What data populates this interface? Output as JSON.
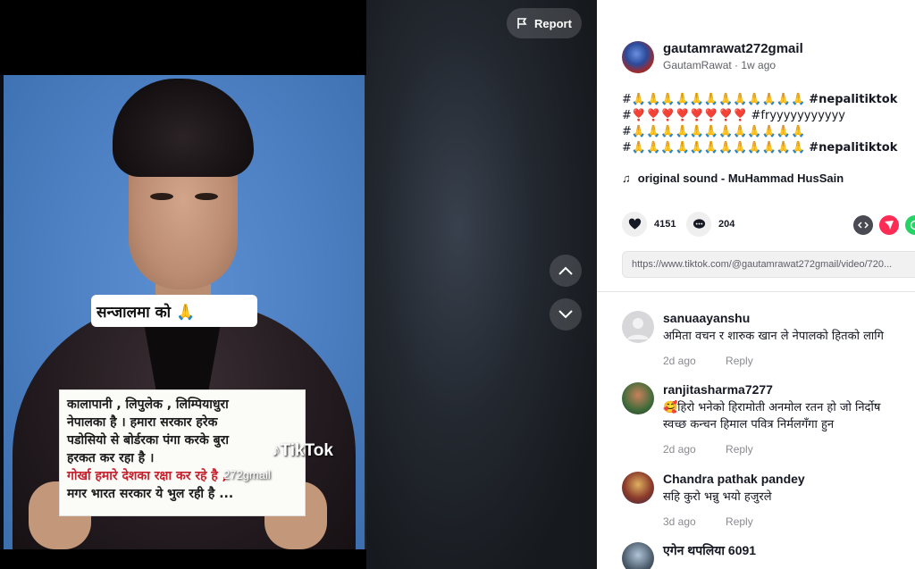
{
  "video": {
    "report_label": "Report",
    "overlay_caption": "सन्जालमा     को 🙏",
    "note_lines": [
      "कालापानी , लिपुलेक ,  लिम्पियाधुरा",
      "नेपालका है ।   हमारा सरकार हरेक",
      "पडोसियो से बोर्डरका पंगा करके बुरा",
      "हरकत कर रहा है ।"
    ],
    "note_red_line": "गोर्खा हमारे देशका रक्षा कर रहे है ,",
    "note_last_line": "मगर भारत सरकार ये भुल रही है ...",
    "watermark": "TikTok",
    "watermark_user": "272gmail"
  },
  "author": {
    "username": "gautamrawat272gmail",
    "display_name": "GautamRawat",
    "time_ago": "1w ago"
  },
  "description": {
    "line1_prefix": "#🙏🙏🙏🙏🙏🙏🙏🙏🙏🙏🙏🙏",
    "line1_tag": "#nepalitiktok",
    "line2_prefix": "#❣️❣️❣️❣️❣️❣️❣️❣️",
    "line2_tag": "#fryyyyyyyyyyy",
    "line3": "#🙏🙏🙏🙏🙏🙏🙏🙏🙏🙏🙏🙏",
    "line4_prefix": "#🙏🙏🙏🙏🙏🙏🙏🙏🙏🙏🙏🙏",
    "line4_tag": "#nepalitiktok"
  },
  "sound": {
    "label": "original sound - MuHammad HusSain"
  },
  "stats": {
    "likes": "4151",
    "comments": "204"
  },
  "share_link": "https://www.tiktok.com/@gautamrawat272gmail/video/720...",
  "comments": [
    {
      "name": "sanuaayanshu",
      "text": "अमिता वचन र शारुक खान ले नेपालको हितको लागि",
      "time": "2d ago",
      "reply": "Reply"
    },
    {
      "name": "ranjitasharma7277",
      "text": "🥰हिरो भनेको हिरामोती अनमोल रतन हो जो निर्दोष",
      "text2": "स्वच्छ कन्चन हिमाल पवित्र निर्मलगँगा हुन",
      "time": "2d ago",
      "reply": "Reply"
    },
    {
      "name": "Chandra pathak pandey",
      "text": "सहि कुरो भन्नु भयो हजुरले",
      "time": "3d ago",
      "reply": "Reply"
    },
    {
      "name": "एगेन थपलिया 6091",
      "text": "",
      "time": "",
      "reply": ""
    }
  ],
  "colors": {
    "accent": "#fe2c55",
    "whatsapp": "#25d366"
  }
}
